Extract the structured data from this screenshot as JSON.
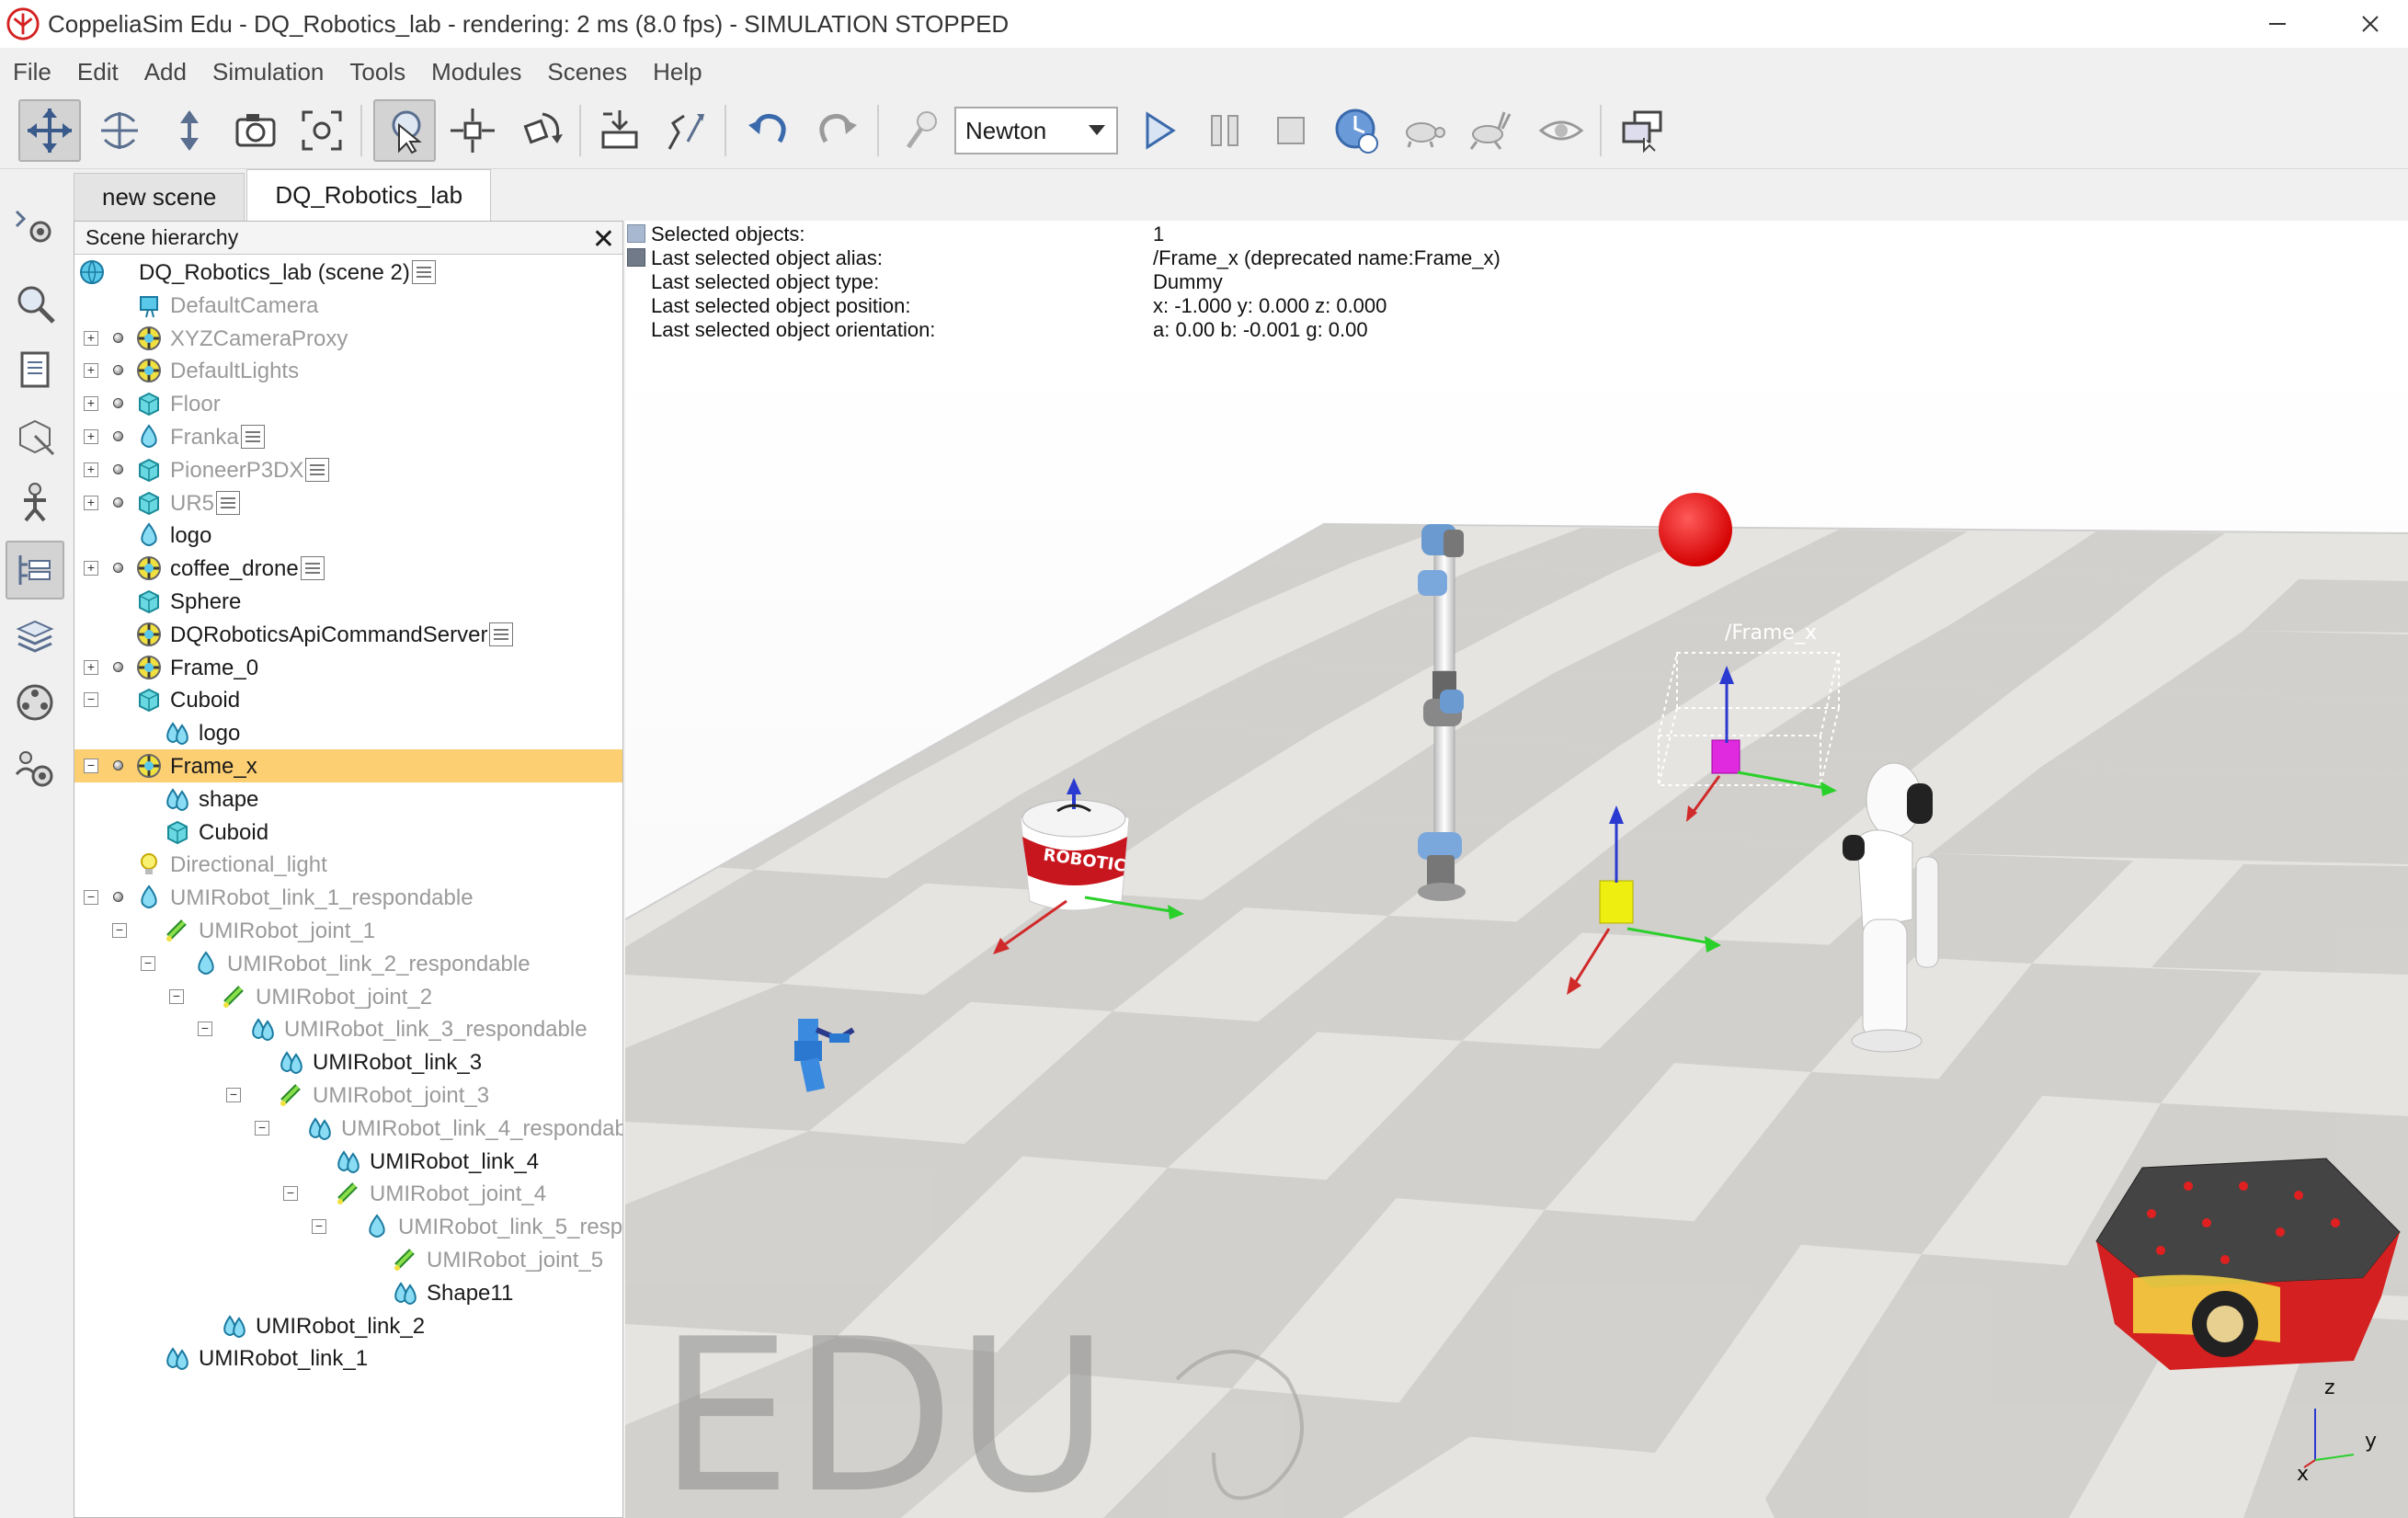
{
  "window": {
    "title": "CoppeliaSim Edu - DQ_Robotics_lab - rendering: 2 ms (8.0 fps) - SIMULATION STOPPED",
    "minimize": "—",
    "maximize": "☐",
    "close": "✕"
  },
  "menu": [
    "File",
    "Edit",
    "Add",
    "Simulation",
    "Tools",
    "Modules",
    "Scenes",
    "Help"
  ],
  "toolbar": {
    "engine": "Newton"
  },
  "tabs": [
    "new scene",
    "DQ_Robotics_lab"
  ],
  "hierarchy": {
    "title": "Scene hierarchy",
    "close": "✕",
    "rows": [
      {
        "label": "DQ_Robotics_lab (scene 2)"
      },
      {
        "label": "DefaultCamera"
      },
      {
        "label": "XYZCameraProxy"
      },
      {
        "label": "DefaultLights"
      },
      {
        "label": "Floor"
      },
      {
        "label": "Franka"
      },
      {
        "label": "PioneerP3DX"
      },
      {
        "label": "UR5"
      },
      {
        "label": "logo"
      },
      {
        "label": "coffee_drone"
      },
      {
        "label": "Sphere"
      },
      {
        "label": "DQRoboticsApiCommandServer"
      },
      {
        "label": "Frame_0"
      },
      {
        "label": "Cuboid"
      },
      {
        "label": "logo"
      },
      {
        "label": "Frame_x"
      },
      {
        "label": "shape"
      },
      {
        "label": "Cuboid"
      },
      {
        "label": "Directional_light"
      },
      {
        "label": "UMIRobot_link_1_respondable"
      },
      {
        "label": "UMIRobot_joint_1"
      },
      {
        "label": "UMIRobot_link_2_respondable"
      },
      {
        "label": "UMIRobot_joint_2"
      },
      {
        "label": "UMIRobot_link_3_respondable"
      },
      {
        "label": "UMIRobot_link_3"
      },
      {
        "label": "UMIRobot_joint_3"
      },
      {
        "label": "UMIRobot_link_4_respondabl"
      },
      {
        "label": "UMIRobot_link_4"
      },
      {
        "label": "UMIRobot_joint_4"
      },
      {
        "label": "UMIRobot_link_5_respor"
      },
      {
        "label": "UMIRobot_joint_5"
      },
      {
        "label": "Shape11"
      },
      {
        "label": "UMIRobot_link_2"
      },
      {
        "label": "UMIRobot_link_1"
      }
    ]
  },
  "info": {
    "selected_objects_key": "Selected objects:",
    "selected_objects_val": "1",
    "alias_key": "Last selected object alias:",
    "alias_val": "/Frame_x    (deprecated name:Frame_x)",
    "type_key": "Last selected object type:",
    "type_val": "Dummy",
    "position_key": "Last selected object position:",
    "position_val": "x: -1.000    y: 0.000    z: 0.000",
    "orientation_key": "Last selected object orientation:",
    "orientation_val": "a: 0.00    b: -0.001    g: 0.00"
  },
  "scene": {
    "frame_label": "/Frame_x",
    "drone_text": "ROBOTIC",
    "watermark": "EDU",
    "axis_z": "z",
    "axis_y": "y",
    "axis_x": "x"
  }
}
